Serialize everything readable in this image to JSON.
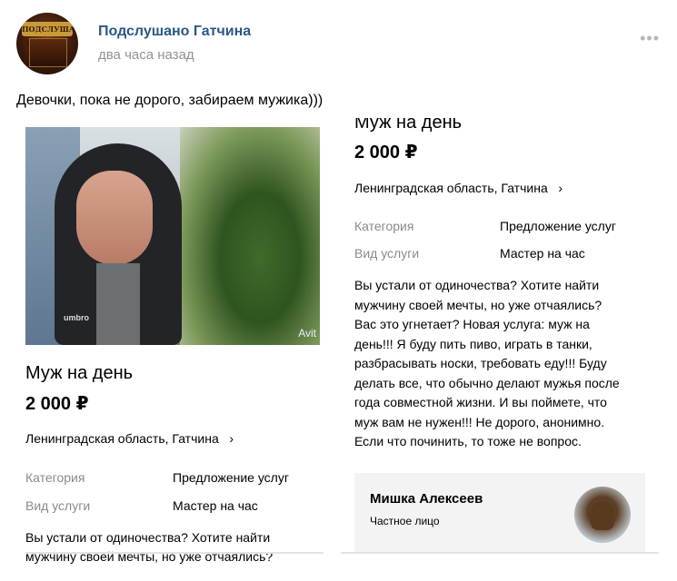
{
  "header": {
    "group_name": "Подслушано Гатчина",
    "time": "два часа назад",
    "more_icon": "more-dots-icon",
    "avatar_text": "ПОДСЛУШАНО ГАТЧИНА"
  },
  "post": {
    "text": "Девочки, пока не дорого, забираем мужика)))"
  },
  "left_listing": {
    "photo_watermark": "Avit",
    "title": "Муж на день",
    "price": "2 000 ₽",
    "location": "Ленинградская область, Гатчина",
    "category_label": "Категория",
    "category_value": "Предложение услуг",
    "service_label": "Вид услуги",
    "service_value": "Мастер на час",
    "desc_line1": "Вы устали от одиночества? Хотите найти",
    "desc_line2": "мужчину своей мечты, но уже отчаялись?"
  },
  "right_listing": {
    "title": "Муж на день",
    "price": "2 000 ₽",
    "location": "Ленинградская область, Гатчина",
    "category_label": "Категория",
    "category_value": "Предложение услуг",
    "service_label": "Вид услуги",
    "service_value": "Мастер на час",
    "desc_lines": [
      "Вы устали от одиночества? Хотите найти",
      "мужчину своей мечты, но уже отчаялись?",
      "Вас это угнетает? Новая услуга: муж на",
      "день!!! Я буду пить пиво, играть в танки,",
      "разбрасывать носки, требовать еду!!! Буду",
      "делать все, что обычно делают мужья после",
      "года совместной жизни. И вы поймете, что",
      "муж вам  не нужен!!! Не дорого, анонимно.",
      "Если что починить, то тоже не вопрос."
    ],
    "seller_name": "Мишка Алексеев",
    "seller_type": "Частное лицо"
  },
  "colors": {
    "link": "#2a5885",
    "muted": "#939393",
    "label": "#8a8a8a",
    "seller_bg": "#f3f3f3"
  }
}
